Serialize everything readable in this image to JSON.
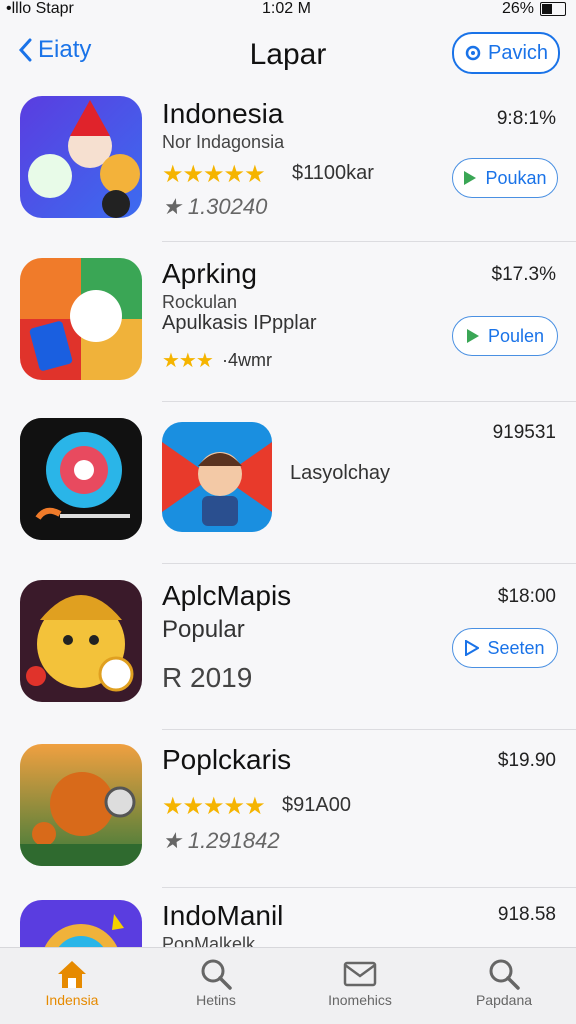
{
  "status": {
    "carrier": "•lllo Stapr",
    "time": "1:02 M",
    "battery": "26%"
  },
  "nav": {
    "back_label": "Eiaty",
    "title": "Lapar",
    "right_button": "Pavich"
  },
  "apps": [
    {
      "name": "Indonesia",
      "sub": "Nor Indagonsia",
      "stars": "★★★★★",
      "stars_extra": "$1100kar",
      "meta": "★ 1.30240",
      "price": "9:8:1%",
      "button": "Poukan"
    },
    {
      "name": "Aprking",
      "sub": "Rockulan",
      "sub2": "Apulkasis IPpplar",
      "stars": "★★★",
      "stars_extra": "·4wmr",
      "price": "$17.3%",
      "button": "Poulen"
    },
    {
      "name": "",
      "sub": "Lasyolchay",
      "price": "919531"
    },
    {
      "name": "AplcMapis",
      "sub": "Popular",
      "meta": "R 2019",
      "price": "$18:00",
      "button": "Seeten"
    },
    {
      "name": "Poplckaris",
      "stars": "★★★★★",
      "stars_extra": "$91A00",
      "meta": "★ 1.291842",
      "price": "$19.90"
    },
    {
      "name": "IndoManil",
      "sub": "PopMalkelk",
      "price": "918.58"
    }
  ],
  "tabs": [
    {
      "label": "Indensia",
      "icon": "home-icon"
    },
    {
      "label": "Hetins",
      "icon": "search-icon"
    },
    {
      "label": "Inomehics",
      "icon": "mail-icon"
    },
    {
      "label": "Papdana",
      "icon": "search-icon"
    }
  ],
  "colors": {
    "accent": "#1a73e8",
    "star": "#f5b400",
    "tab_active": "#e68a00"
  }
}
